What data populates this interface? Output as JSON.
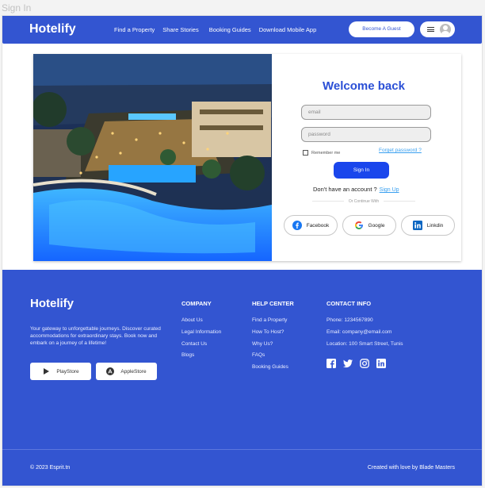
{
  "frame": {
    "label": "Sign In"
  },
  "header": {
    "logo": "Hotelify",
    "nav": [
      "Find a Property",
      "Share Stories",
      "Booking Guides",
      "Download Mobile App"
    ],
    "cta_label": "Become A Guest",
    "brand_color": "#3355d1"
  },
  "login": {
    "title": "Welcome back",
    "email_placeholder": "email",
    "password_placeholder": "password",
    "remember_label": "Remember me",
    "forgot_label": "Forget password ?",
    "signin_label": "Sign In",
    "no_account_text": "Don't have an account ?",
    "signup_label": "Sign Up",
    "continue_text": "Or Continue With",
    "social": [
      {
        "label": "Facebook",
        "icon": "facebook-icon"
      },
      {
        "label": "Google",
        "icon": "google-icon"
      },
      {
        "label": "Linkdin",
        "icon": "linkedin-icon"
      }
    ],
    "accent_color": "#1a46ec"
  },
  "footer": {
    "logo": "Hotelify",
    "tagline": "Your gateway to unforgettable journeys. Discover curated accommodations for extraordinary stays. Book now and embark on a journey of a lifetime!",
    "stores": [
      {
        "label": "PlayStore",
        "icon": "play-store-icon"
      },
      {
        "label": "AppleStore",
        "icon": "app-store-icon"
      }
    ],
    "company": {
      "title": "COMPANY",
      "links": [
        "About Us",
        "Legal Information",
        "Contact Us",
        "Blogs"
      ]
    },
    "help": {
      "title": "HELP CENTER",
      "links": [
        "Find a Property",
        "How To Host?",
        "Why Us?",
        "FAQs",
        "Booking Guides"
      ]
    },
    "contact": {
      "title": "CONTACT INFO",
      "phone": "Phone: 1234567890",
      "email": "Email: company@email.com",
      "location": "Location: 100 Smart Street, Tunis"
    },
    "social_icons": [
      "facebook-icon",
      "twitter-icon",
      "instagram-icon",
      "linkedin-icon"
    ],
    "copyright": "© 2023 Esprit.tn",
    "credit": "Created with love by Blade Masters"
  }
}
